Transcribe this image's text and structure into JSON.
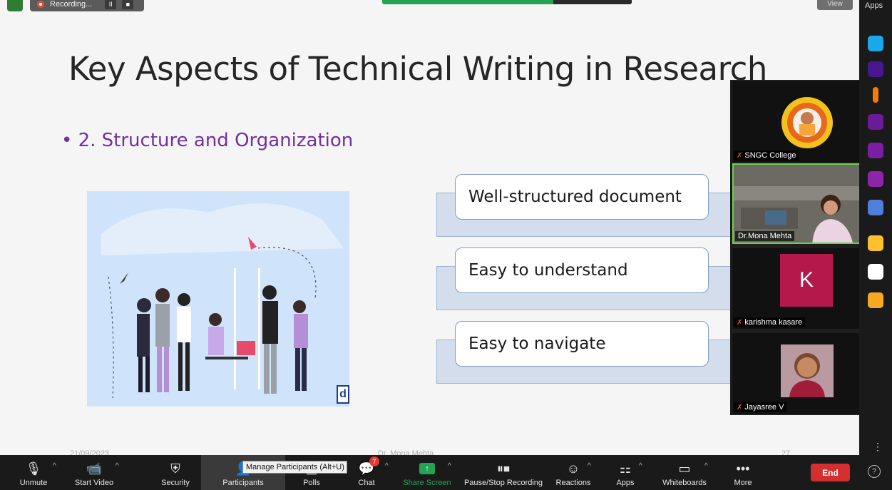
{
  "recording": {
    "label": "Recording...",
    "pause": "II",
    "stop": "■"
  },
  "view_label": "View",
  "apps_label": "Apps",
  "slide": {
    "title": "Key Aspects of Technical Writing in Research",
    "bullet": "• 2. Structure and Organization",
    "items": [
      "Well-structured document",
      "Easy to understand",
      "Easy to navigate"
    ],
    "logo_letter": "d",
    "footer_date": "21/09/2023",
    "footer_center": "Dr. Mona Mehta",
    "footer_page": "27"
  },
  "participants": [
    {
      "name": "SNGC College",
      "muted": true
    },
    {
      "name": "Dr.Mona Mehta",
      "muted": false,
      "active": true
    },
    {
      "name": "karishma kasare",
      "muted": true,
      "initial": "K"
    },
    {
      "name": "Jayasree V",
      "muted": true
    }
  ],
  "toolbar": {
    "unmute": "Unmute",
    "start_video": "Start Video",
    "security": "Security",
    "participants": "Participants",
    "polls": "Polls",
    "chat": "Chat",
    "chat_badge": "7",
    "share_screen": "Share Screen",
    "pause_stop": "Pause/Stop Recording",
    "reactions": "Reactions",
    "apps": "Apps",
    "whiteboards": "Whiteboards",
    "more": "More",
    "end": "End",
    "tooltip": "Manage Participants (Alt+U)"
  },
  "colors": {
    "accent_green": "#23a455",
    "end_red": "#d32f2f",
    "bullet_purple": "#7030a0"
  }
}
